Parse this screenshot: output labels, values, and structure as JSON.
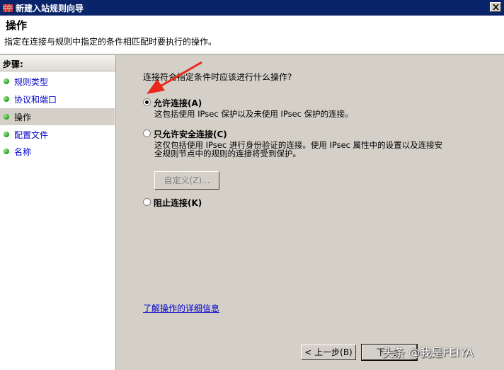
{
  "window": {
    "title": "新建入站规则向导"
  },
  "header": {
    "title": "操作",
    "description": "指定在连接与规则中指定的条件相匹配时要执行的操作。"
  },
  "sidebar": {
    "heading": "步骤:",
    "items": [
      {
        "label": "规则类型"
      },
      {
        "label": "协议和端口"
      },
      {
        "label": "操作"
      },
      {
        "label": "配置文件"
      },
      {
        "label": "名称"
      }
    ],
    "active_index": 2
  },
  "main": {
    "question": "连接符合指定条件时应该进行什么操作?",
    "options": [
      {
        "label": "允许连接(A)",
        "description": "这包括使用 IPsec 保护以及未使用 IPsec 保护的连接。",
        "checked": true
      },
      {
        "label": "只允许安全连接(C)",
        "description_line1": "这仅包括使用 IPsec 进行身份验证的连接。使用 IPsec 属性中的设置以及连接安",
        "description_line2": "全规则节点中的规则的连接将受到保护。",
        "checked": false
      },
      {
        "label": "阻止连接(K)",
        "checked": false
      }
    ],
    "customize_button": "自定义(Z)...",
    "learn_more_link": "了解操作的详细信息"
  },
  "footer": {
    "back_button": "< 上一步(B)",
    "next_button": "下一步"
  },
  "watermark": "头条 @我是FEIYA",
  "colors": {
    "titlebar": "#0a246a",
    "link": "#0000cc",
    "arrow": "#e8291b"
  }
}
